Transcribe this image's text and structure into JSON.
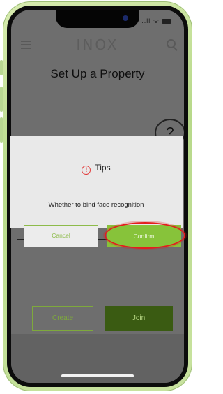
{
  "app": {
    "logo_text": "INOX",
    "page_title": "Set Up a Property",
    "help_symbol": "?"
  },
  "status_bar": {
    "signal_text": "..ll ᯤ"
  },
  "dialog": {
    "title": "Tips",
    "icon": "alert-circle-icon",
    "message": "Whether to bind face recognition",
    "cancel_label": "Cancel",
    "confirm_label": "Confirm"
  },
  "actions": {
    "create_label": "Create",
    "join_label": "Join"
  },
  "colors": {
    "accent_green": "#87c33a",
    "dark_green": "#3a5b12",
    "highlight_red": "#e41d1d",
    "tips_icon_red": "#e23a3a"
  }
}
